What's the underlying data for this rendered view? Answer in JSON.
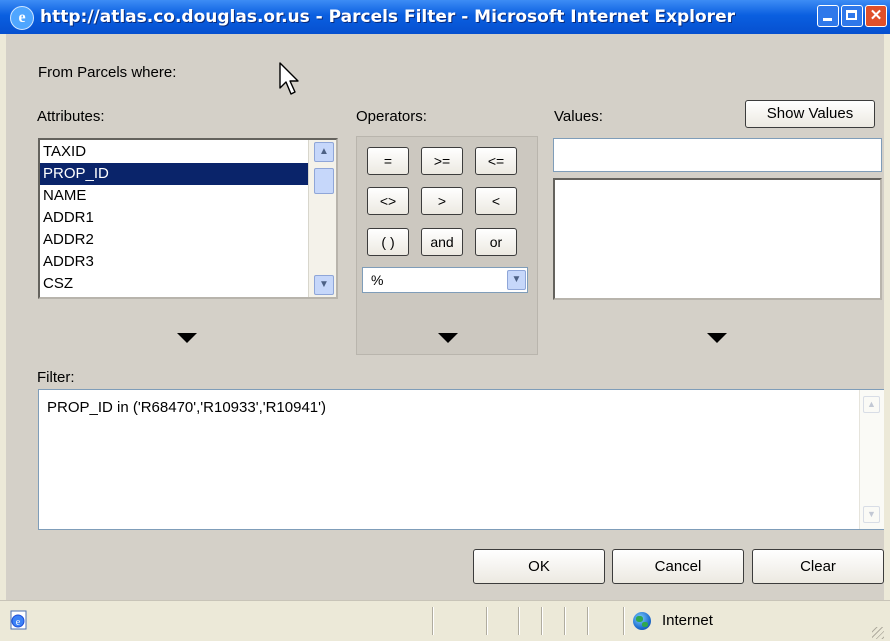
{
  "window": {
    "title": "http://atlas.co.douglas.or.us - Parcels Filter - Microsoft Internet Explorer",
    "close_glyph": "✕"
  },
  "dialog": {
    "from_label": "From Parcels where:",
    "attributes_label": "Attributes:",
    "operators_label": "Operators:",
    "values_label": "Values:",
    "show_values_label": "Show Values",
    "attributes": [
      "TAXID",
      "PROP_ID",
      "NAME",
      "ADDR1",
      "ADDR2",
      "ADDR3",
      "CSZ"
    ],
    "selected_attribute": "PROP_ID",
    "operators": {
      "eq": "=",
      "gte": ">=",
      "lte": "<=",
      "ne": "<>",
      "gt": ">",
      "lt": "<",
      "parens": "( )",
      "and": "and",
      "or": "or"
    },
    "operator_select_value": "%",
    "values_input_value": "",
    "filter_label": "Filter:",
    "filter_text": "PROP_ID in ('R68470','R10933','R10941')",
    "ok_label": "OK",
    "cancel_label": "Cancel",
    "clear_label": "Clear"
  },
  "statusbar": {
    "zone_label": "Internet"
  },
  "colors": {
    "selection": "#0a246a",
    "titlebar": "#0a5fe0",
    "dialog_bg": "#d4d0c8"
  }
}
